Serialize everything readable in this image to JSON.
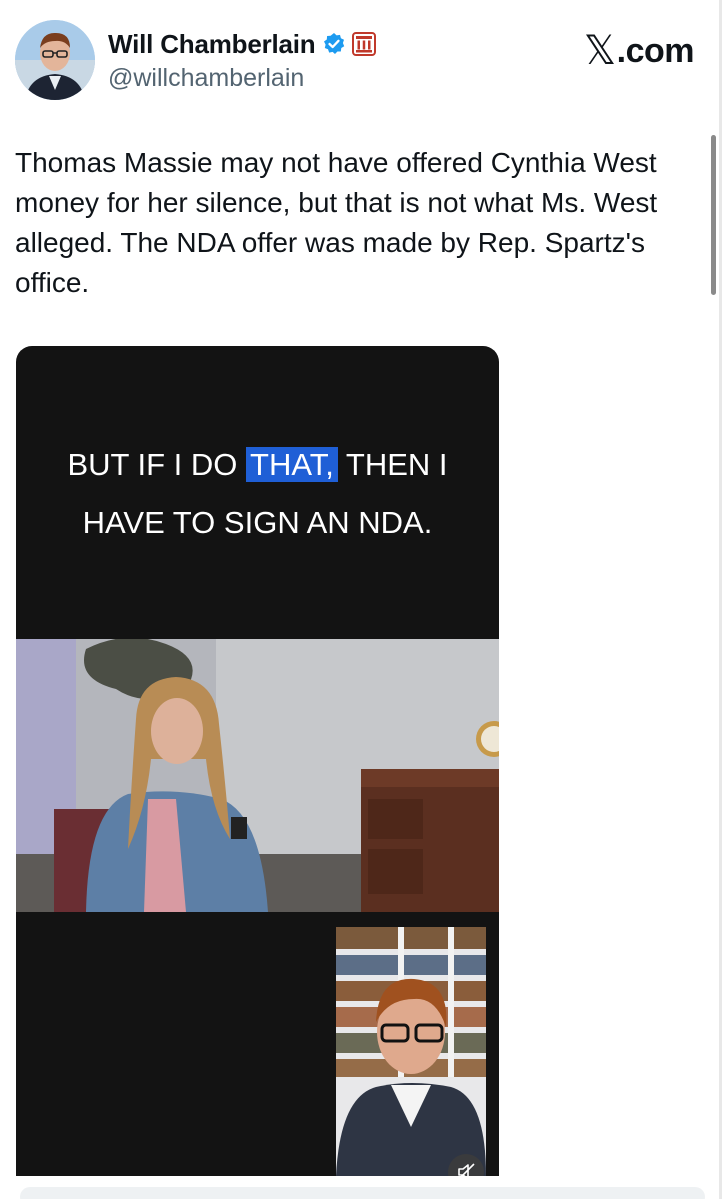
{
  "tweet": {
    "author_name": "Will Chamberlain",
    "handle": "@willchamberlain",
    "site_label": ".com",
    "site_mark": "𝕏",
    "text": "Thomas Massie may not have offered Cynthia West money for her silence, but that is not what Ms. West alleged. The NDA offer was made by Rep. Spartz's office.",
    "verified_icon": "verified-check-icon",
    "affiliation_icon": "affiliation-badge-icon"
  },
  "video": {
    "caption_line1_pre": "BUT IF I DO ",
    "caption_line1_highlight": "THAT,",
    "caption_line1_post": " THEN I",
    "caption_line2": "HAVE TO SIGN AN NDA.",
    "highlight_color": "#1f5fd6",
    "mute_icon": "muted-speaker-icon"
  },
  "colors": {
    "verified": "#1d9bf0",
    "affiliation": "#c0392b",
    "handle": "#536471"
  }
}
